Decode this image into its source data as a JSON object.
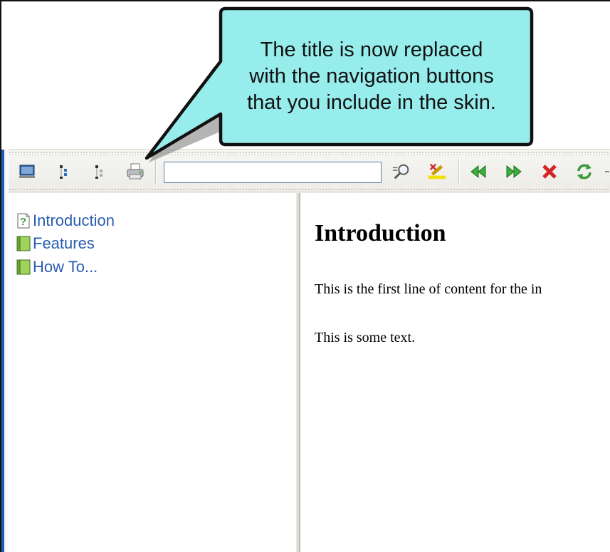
{
  "callout": {
    "line1": "The title is now replaced",
    "line2": "with the navigation buttons",
    "line3": "that you include in the skin."
  },
  "toolbar": {
    "search_value": "",
    "icons": [
      "hide-navigation-icon",
      "expand-all-icon",
      "collapse-all-icon",
      "print-icon",
      "search-icon",
      "remove-highlight-icon",
      "back-icon",
      "forward-icon",
      "stop-icon",
      "refresh-icon"
    ]
  },
  "toc": {
    "items": [
      {
        "label": "Introduction",
        "icon": "topic-icon"
      },
      {
        "label": "Features",
        "icon": "book-icon"
      },
      {
        "label": "How To...",
        "icon": "book-icon"
      }
    ]
  },
  "topic": {
    "title": "Introduction",
    "line1": "This is the first line of content for the in",
    "line2": "This is some text."
  },
  "colors": {
    "callout_fill": "#97ecec",
    "link": "#2a5db0",
    "accent": "#1f5fb5"
  }
}
